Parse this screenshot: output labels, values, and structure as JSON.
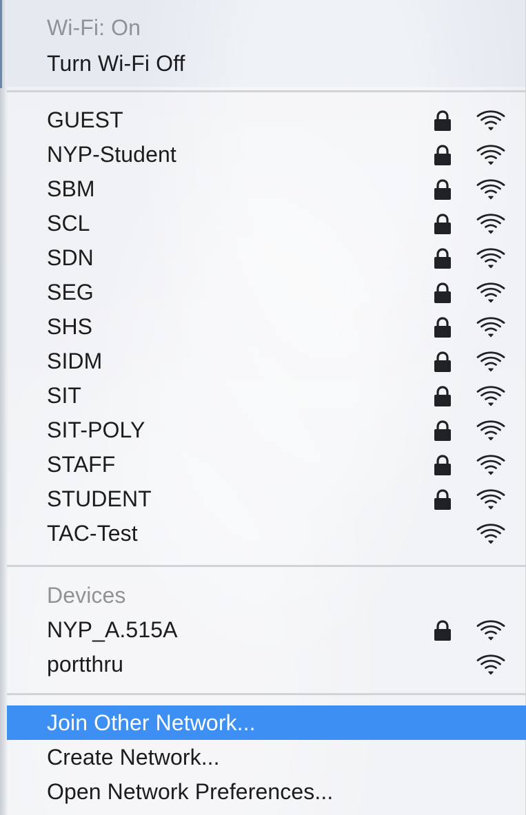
{
  "wifi": {
    "status_label": "Wi-Fi: On",
    "toggle_label": "Turn Wi-Fi Off"
  },
  "networks": [
    {
      "name": "GUEST",
      "secure": true
    },
    {
      "name": "NYP-Student",
      "secure": true
    },
    {
      "name": "SBM",
      "secure": true
    },
    {
      "name": "SCL",
      "secure": true
    },
    {
      "name": "SDN",
      "secure": true
    },
    {
      "name": "SEG",
      "secure": true
    },
    {
      "name": "SHS",
      "secure": true
    },
    {
      "name": "SIDM",
      "secure": true
    },
    {
      "name": "SIT",
      "secure": true
    },
    {
      "name": "SIT-POLY",
      "secure": true
    },
    {
      "name": "STAFF",
      "secure": true
    },
    {
      "name": "STUDENT",
      "secure": true
    },
    {
      "name": "TAC-Test",
      "secure": false
    }
  ],
  "devices": {
    "header": "Devices",
    "items": [
      {
        "name": "NYP_A.515A",
        "secure": true
      },
      {
        "name": "portthru",
        "secure": false
      }
    ]
  },
  "actions": {
    "join_other": "Join Other Network...",
    "create_network": "Create Network...",
    "open_preferences": "Open Network Preferences..."
  },
  "icons": {
    "lock": "lock-icon",
    "wifi": "wifi-icon"
  },
  "colors": {
    "highlight": "#3d8ff4",
    "text": "#1c1c1e",
    "secondary_text": "#8f9398"
  }
}
